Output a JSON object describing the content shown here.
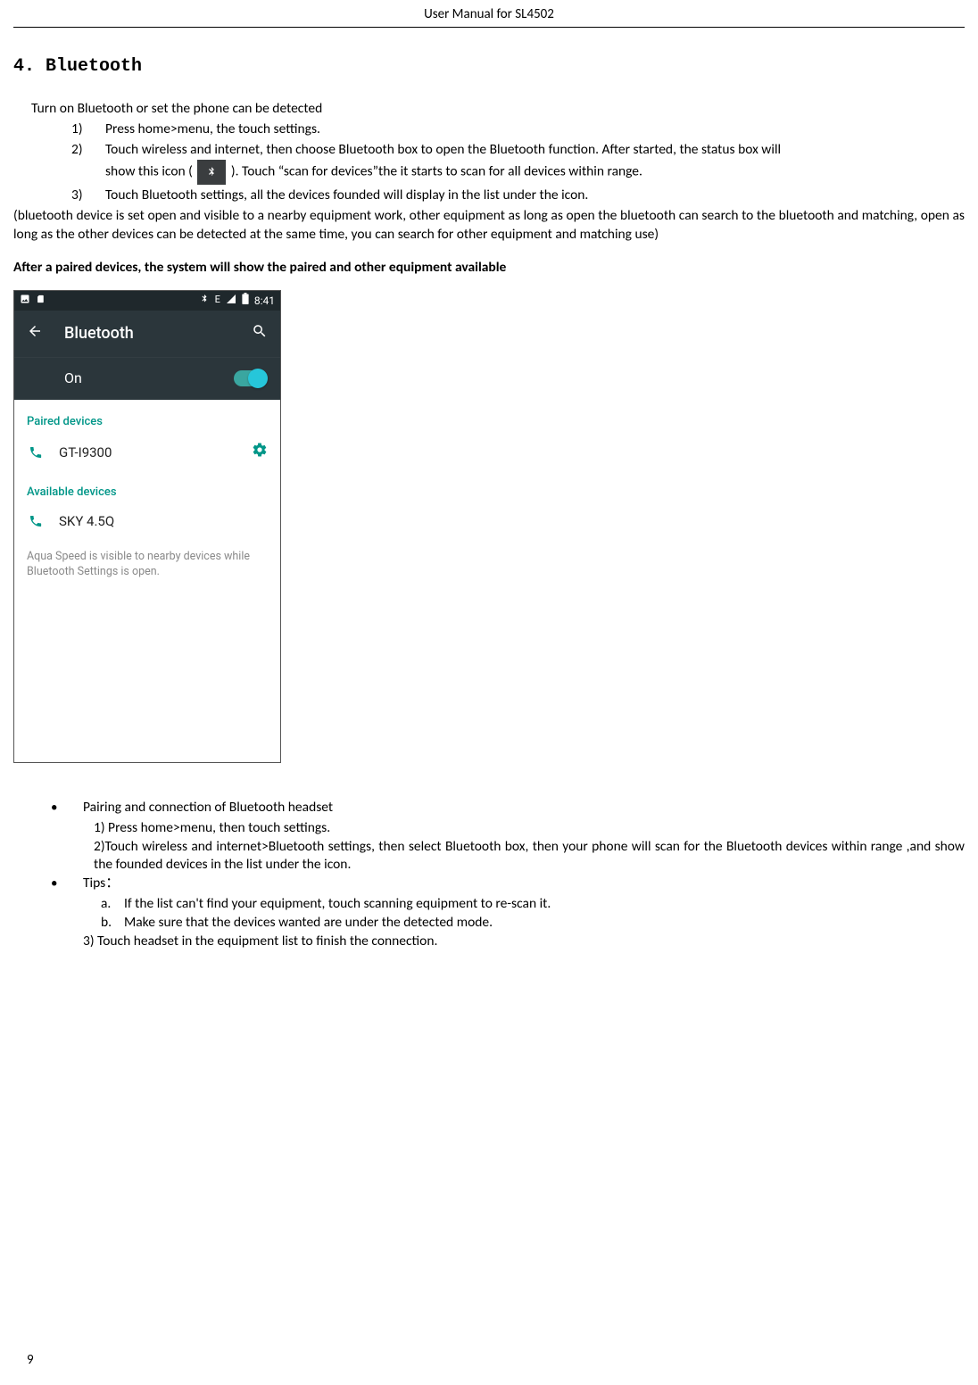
{
  "header": {
    "title": "User Manual for SL4502"
  },
  "section": {
    "heading": "4. Bluetooth"
  },
  "intro": "Turn on Bluetooth or set the phone can be detected",
  "steps": {
    "s1": {
      "num": "1)",
      "text": "Press home>menu, the touch settings."
    },
    "s2": {
      "num": "2)",
      "line1": "Touch wireless and internet, then choose Bluetooth box to open the Bluetooth function. After started, the status box will",
      "line2a": "show this icon (",
      "line2b": "). Touch  “scan for devices”the it starts to scan for all devices within range."
    },
    "s3": {
      "num": "3)",
      "text": "Touch Bluetooth settings, all the devices founded will display in the list under the icon."
    }
  },
  "para1": "(bluetooth device is set open and visible to a nearby equipment work, other equipment as long as open the bluetooth can search to the bluetooth and matching, open as long as the other devices can be detected at the same time, you can search for other equipment and matching use)",
  "bold_line": "After a paired devices, the system will show the paired and other equipment available",
  "phone": {
    "status": {
      "net": "E",
      "time": "8:41"
    },
    "appbar": {
      "title": "Bluetooth"
    },
    "toggle_label": "On",
    "paired_label": "Paired devices",
    "paired_device": "GT-I9300",
    "available_label": "Available devices",
    "available_device": "SKY 4.5Q",
    "footer": "Aqua Speed is visible to nearby devices while Bluetooth Settings is open."
  },
  "bullets": {
    "b1": {
      "title": "Pairing and connection of Bluetooth headset",
      "s1": "1) Press home>menu, then touch settings.",
      "s2": "2)Touch wireless and internet>Bluetooth settings, then select Bluetooth box, then your phone will scan for the Bluetooth devices within range ,and show the founded devices in the list under the icon."
    },
    "b2": {
      "title": "Tips：",
      "a_n": "a.",
      "a": "If the list can't find your equipment, touch scanning equipment to re-scan it.",
      "b_n": "b.",
      "b": "Make sure that the devices wanted are under the detected mode.",
      "s3": "3) Touch headset in the equipment list to finish the connection."
    }
  },
  "page_number": "9"
}
